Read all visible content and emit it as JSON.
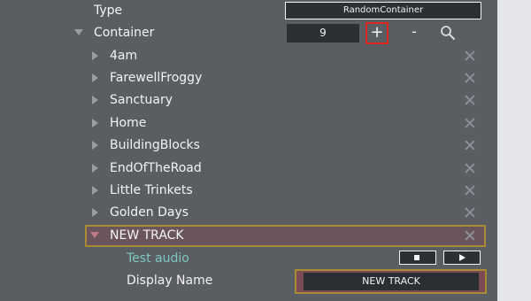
{
  "header": {
    "type_label": "Type",
    "type_value": "RandomContainer",
    "container_label": "Container",
    "container_count": "9",
    "add_label": "+",
    "remove_label": "-"
  },
  "tracks": [
    {
      "name": "4am"
    },
    {
      "name": "FarewellFroggy"
    },
    {
      "name": "Sanctuary"
    },
    {
      "name": "Home"
    },
    {
      "name": "BuildingBlocks"
    },
    {
      "name": "EndOfTheRoad"
    },
    {
      "name": "Little Trinkets"
    },
    {
      "name": "Golden Days"
    }
  ],
  "selected_track": {
    "name": "NEW TRACK",
    "test_audio_label": "Test audio",
    "display_name_label": "Display Name",
    "display_name_value": "NEW TRACK"
  },
  "colors": {
    "background": "#5a5e63",
    "highlight_border": "#a98a35",
    "add_button_border": "#e0261e",
    "test_audio_text": "#7fc7c0"
  },
  "icons": {
    "collapsed": "triangle-right",
    "expanded": "triangle-down",
    "delete": "close-x",
    "search": "magnifier",
    "stop": "square",
    "play": "triangle-right"
  }
}
